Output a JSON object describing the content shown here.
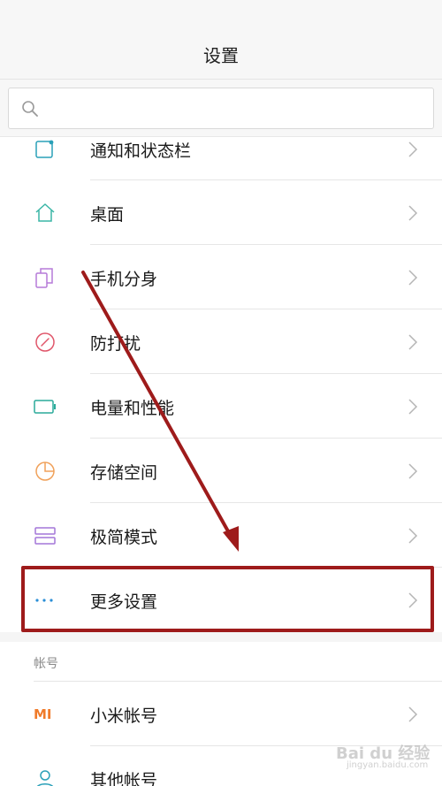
{
  "header": {
    "title": "设置"
  },
  "search": {
    "placeholder": ""
  },
  "items": [
    {
      "label": "通知和状态栏",
      "icon": "notification-icon",
      "color": "#2aa0b8"
    },
    {
      "label": "桌面",
      "icon": "home-icon",
      "color": "#3ab6a6"
    },
    {
      "label": "手机分身",
      "icon": "dual-phone-icon",
      "color": "#b57ad8"
    },
    {
      "label": "防打扰",
      "icon": "do-not-disturb-icon",
      "color": "#e0566a"
    },
    {
      "label": "电量和性能",
      "icon": "battery-icon",
      "color": "#2aaa9a"
    },
    {
      "label": "存储空间",
      "icon": "pie-storage-icon",
      "color": "#f0a15a"
    },
    {
      "label": "极简模式",
      "icon": "simple-mode-icon",
      "color": "#a476d8"
    },
    {
      "label": "更多设置",
      "icon": "more-dots-icon",
      "color": "#2b8fd6"
    }
  ],
  "account_section": {
    "header": "帐号",
    "items": [
      {
        "label": "小米帐号",
        "icon": "mi-logo-icon",
        "badge": "MI",
        "color": "#f07b2a"
      },
      {
        "label": "其他帐号",
        "icon": "person-icon",
        "color": "#2aa0b8"
      }
    ]
  },
  "annotation": {
    "color": "#9e1b1b"
  },
  "watermark": {
    "text": "Bai du 经验",
    "sub": "jingyan.baidu.com"
  }
}
